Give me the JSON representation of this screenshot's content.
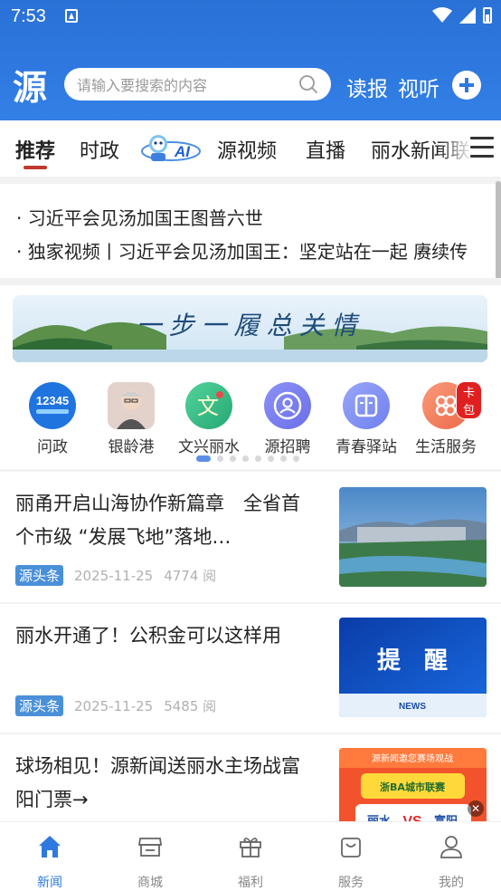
{
  "status": {
    "time": "7:53"
  },
  "header": {
    "logo": "源",
    "search_placeholder": "请输入要搜索的内容",
    "read_label": "读报",
    "listen_label": "视听"
  },
  "tabs": [
    {
      "label": "推荐",
      "active": true
    },
    {
      "label": "时政"
    },
    {
      "label": "AI",
      "icon": "ai-mascot-icon"
    },
    {
      "label": "源视频"
    },
    {
      "label": "直播"
    },
    {
      "label": "丽水新闻联"
    }
  ],
  "headlines": [
    "· 习近平会见汤加国王图普六世",
    "· 独家视频丨习近平会见汤加国王：坚定站在一起 赓续传"
  ],
  "banner": {
    "text": "一步一履总关情"
  },
  "entries": [
    {
      "label": "问政",
      "icon": "12345-hotline-icon",
      "color": "#1f74e0"
    },
    {
      "label": "银龄港",
      "icon": "elderly-man-icon",
      "color": "#d9c7c0"
    },
    {
      "label": "文兴丽水",
      "icon": "culture-wen-icon",
      "color": "#37c08a"
    },
    {
      "label": "源招聘",
      "icon": "recruit-person-icon",
      "color": "#7b7ff0"
    },
    {
      "label": "青春驿站",
      "icon": "book-icon",
      "color": "#7d8cf5"
    },
    {
      "label": "生活服务",
      "icon": "clover-icon",
      "color": "#f27e5e",
      "badge": "卡包"
    }
  ],
  "pager": {
    "count": 8,
    "active": 0
  },
  "news": [
    {
      "title": "丽甬开启山海协作新篇章　全省首个市级 “发展飞地”落地…",
      "source": "源头条",
      "date": "2025-11-25",
      "views": "4774 阅",
      "thumb": "aerial-city-river-image"
    },
    {
      "title": "丽水开通了！公积金可以这样用",
      "source": "源头条",
      "date": "2025-11-25",
      "views": "5485 阅",
      "thumb": "reminder-news-image",
      "thumb_text": "提　醒",
      "thumb_sub": "NEWS"
    },
    {
      "title": "球场相见！源新闻送丽水主场战富阳门票→",
      "thumb": "football-match-promo-image",
      "thumb_header": "源新闻邀您赛场观战",
      "thumb_team1": "丽水",
      "thumb_vs": "VS",
      "thumb_team2": "富阳",
      "thumb_slogan": "浙BA城市联赛"
    }
  ],
  "bottom_nav": [
    {
      "label": "新闻",
      "icon": "home-icon",
      "active": true
    },
    {
      "label": "商城",
      "icon": "shop-icon"
    },
    {
      "label": "福利",
      "icon": "gift-icon"
    },
    {
      "label": "服务",
      "icon": "bag-icon"
    },
    {
      "label": "我的",
      "icon": "profile-icon"
    }
  ],
  "colors": {
    "primary": "#2e79e0",
    "tab_underline": "#c0392b",
    "source_tag": "#4a90d9"
  }
}
